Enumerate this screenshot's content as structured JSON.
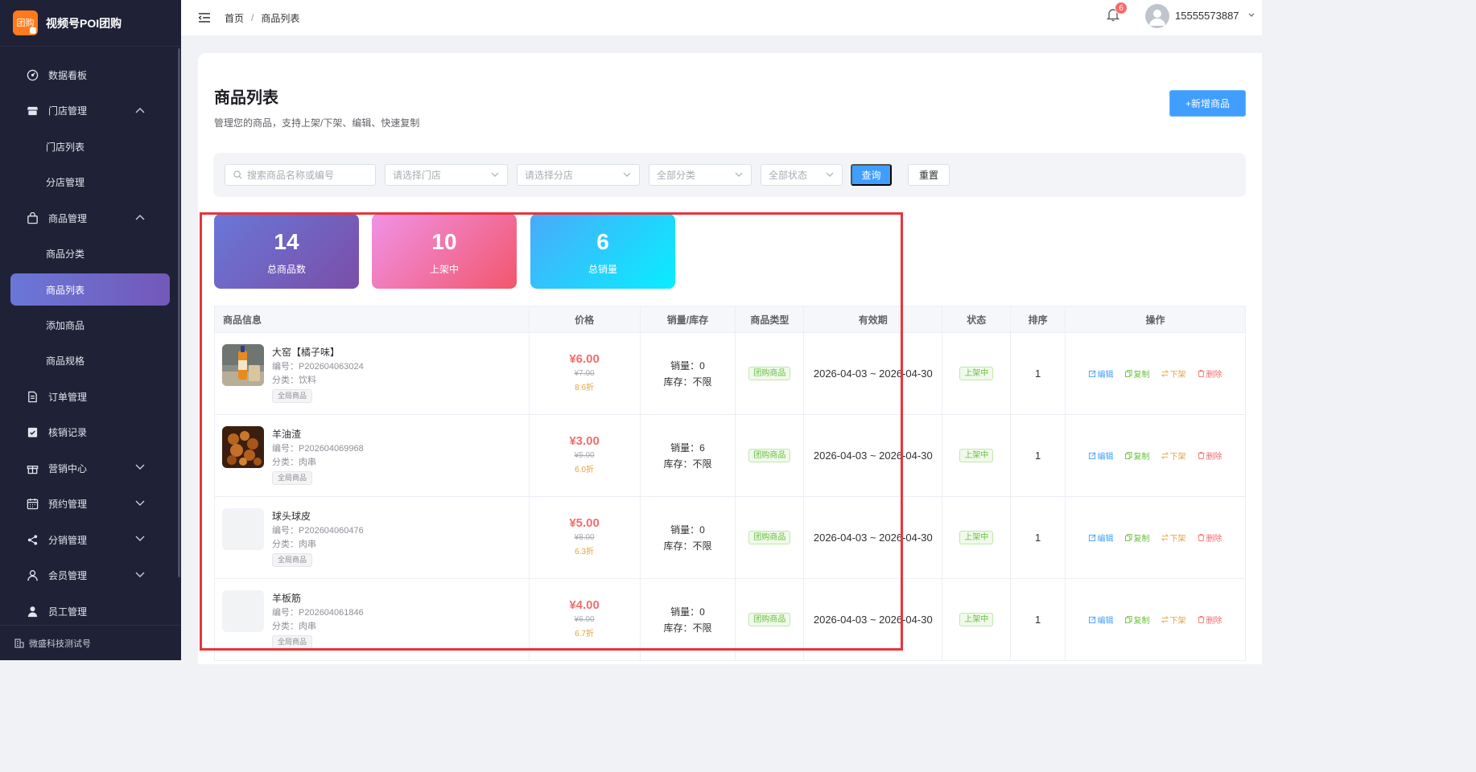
{
  "app": {
    "logo_text": "团购",
    "title": "视频号POI团购"
  },
  "sidebar": {
    "items": [
      {
        "label": "数据看板",
        "icon": "dashboard-icon"
      },
      {
        "label": "门店管理",
        "icon": "store-icon"
      },
      {
        "label": "门店列表"
      },
      {
        "label": "分店管理"
      },
      {
        "label": "商品管理",
        "icon": "shopping-bag-icon"
      },
      {
        "label": "商品分类"
      },
      {
        "label": "商品列表"
      },
      {
        "label": "添加商品"
      },
      {
        "label": "商品规格"
      },
      {
        "label": "订单管理",
        "icon": "order-icon"
      },
      {
        "label": "核销记录",
        "icon": "verify-icon"
      },
      {
        "label": "营销中心",
        "icon": "gift-icon"
      },
      {
        "label": "预约管理",
        "icon": "calendar-icon"
      },
      {
        "label": "分销管理",
        "icon": "share-icon"
      },
      {
        "label": "会员管理",
        "icon": "member-icon"
      },
      {
        "label": "员工管理",
        "icon": "staff-icon"
      }
    ],
    "footer": "微盛科技测试号"
  },
  "header": {
    "breadcrumb": [
      "首页",
      "商品列表"
    ],
    "breadcrumb_sep": "/",
    "notification_count": "6",
    "username": "15555573887"
  },
  "page": {
    "title": "商品列表",
    "subtitle": "管理您的商品，支持上架/下架、编辑、快速复制",
    "add_button": "+新增商品"
  },
  "filters": {
    "search_placeholder": "搜索商品名称或编号",
    "store_placeholder": "请选择门店",
    "branch_placeholder": "请选择分店",
    "category": "全部分类",
    "status": "全部状态",
    "query_button": "查询",
    "reset_button": "重置"
  },
  "stats": [
    {
      "value": "14",
      "label": "总商品数"
    },
    {
      "value": "10",
      "label": "上架中"
    },
    {
      "value": "6",
      "label": "总销量"
    }
  ],
  "table": {
    "columns": [
      "商品信息",
      "价格",
      "销量/库存",
      "商品类型",
      "有效期",
      "状态",
      "排序",
      "操作"
    ],
    "actions": {
      "edit": "编辑",
      "copy": "复制",
      "off_shelf": "下架",
      "delete": "删除"
    },
    "rows": [
      {
        "name": "大窑【橘子味】",
        "code": "编号：P202604063024",
        "category": "分类：饮料",
        "scope": "全局商品",
        "price": "¥6.00",
        "original_price": "¥7.00",
        "discount": "8.6折",
        "sales": "销量：0",
        "stock": "库存：不限",
        "type": "团购商品",
        "validity": "2026-04-03 ~ 2026-04-30",
        "status": "上架中",
        "sort": "1",
        "image": "drink-photo"
      },
      {
        "name": "羊油渣",
        "code": "编号：P202604069968",
        "category": "分类：肉串",
        "scope": "全局商品",
        "price": "¥3.00",
        "original_price": "¥5.00",
        "discount": "6.0折",
        "sales": "销量：6",
        "stock": "库存：不限",
        "type": "团购商品",
        "validity": "2026-04-03 ~ 2026-04-30",
        "status": "上架中",
        "sort": "1",
        "image": "skewer-photo"
      },
      {
        "name": "球头球皮",
        "code": "编号：P202604060476",
        "category": "分类：肉串",
        "scope": "全局商品",
        "price": "¥5.00",
        "original_price": "¥8.00",
        "discount": "6.3折",
        "sales": "销量：0",
        "stock": "库存：不限",
        "type": "团购商品",
        "validity": "2026-04-03 ~ 2026-04-30",
        "status": "上架中",
        "sort": "1",
        "image": "placeholder"
      },
      {
        "name": "羊板筋",
        "code": "编号：P202604061846",
        "category": "分类：肉串",
        "scope": "全局商品",
        "price": "¥4.00",
        "original_price": "¥6.00",
        "discount": "6.7折",
        "sales": "销量：0",
        "stock": "库存：不限",
        "type": "团购商品",
        "validity": "2026-04-03 ~ 2026-04-30",
        "status": "上架中",
        "sort": "1",
        "image": "placeholder"
      }
    ]
  },
  "colors": {
    "sidebar_bg": "#1f2136",
    "primary": "#409eff",
    "price": "#f56c6c",
    "highlight_box": "#e8343c"
  }
}
